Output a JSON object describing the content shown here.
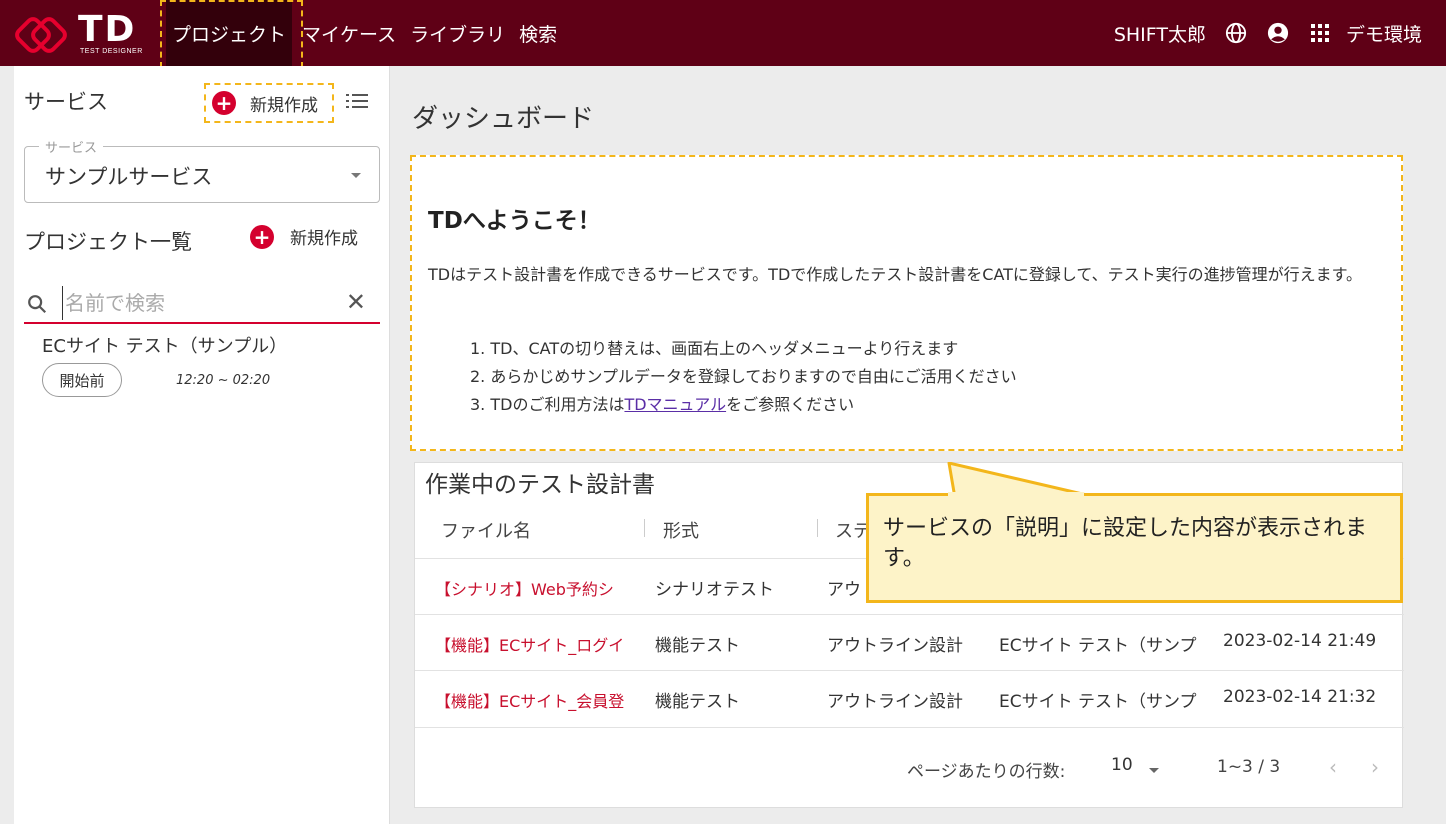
{
  "header": {
    "logo_text": "TD",
    "logo_sub": "TEST DESIGNER",
    "nav": [
      "プロジェクト",
      "マイケース",
      "ライブラリ",
      "検索"
    ],
    "user": "SHIFT太郎",
    "env": "デモ環境",
    "brand_color": "#5f0016"
  },
  "sidebar": {
    "service_title": "サービス",
    "new_label": "新規作成",
    "select_label": "サービス",
    "select_value": "サンプルサービス",
    "project_list_title": "プロジェクト一覧",
    "project_new_label": "新規作成",
    "search_placeholder": "名前で検索",
    "project": {
      "name": "ECサイト テスト（サンプル）",
      "status": "開始前",
      "time": "12:20 ~ 02:20"
    }
  },
  "main": {
    "title": "ダッシュボード",
    "welcome": {
      "title": "TDへようこそ！",
      "desc": "TDはテスト設計書を作成できるサービスです。TDで作成したテスト設計書をCATに登録して、テスト実行の進捗管理が行えます。",
      "item1": "1. TD、CATの切り替えは、画面右上のヘッダメニューより行えます",
      "item2": "2. あらかじめサンプルデータを登録しておりますので自由にご活用ください",
      "item3_prefix": "3. TDのご利用方法は",
      "item3_link": "TDマニュアル",
      "item3_suffix": "をご参照ください"
    },
    "table": {
      "title": "作業中のテスト設計書",
      "headers": [
        "ファイル名",
        "形式",
        "ステ"
      ],
      "rows": [
        {
          "file": "【シナリオ】Web予約シ",
          "type": "シナリオテスト",
          "status": "アウ",
          "project": "",
          "date": ""
        },
        {
          "file": "【機能】ECサイト_ログイ",
          "type": "機能テスト",
          "status": "アウトライン設計",
          "project": "ECサイト テスト（サンプ",
          "date": "2023-02-14 21:49"
        },
        {
          "file": "【機能】ECサイト_会員登",
          "type": "機能テスト",
          "status": "アウトライン設計",
          "project": "ECサイト テスト（サンプ",
          "date": "2023-02-14 21:32"
        }
      ],
      "rows_per_page_label": "ページあたりの行数:",
      "rows_per_page": "10",
      "range": "1~3 / 3"
    }
  },
  "callout": {
    "text": "サービスの「説明」に設定した内容が表示されます。"
  }
}
